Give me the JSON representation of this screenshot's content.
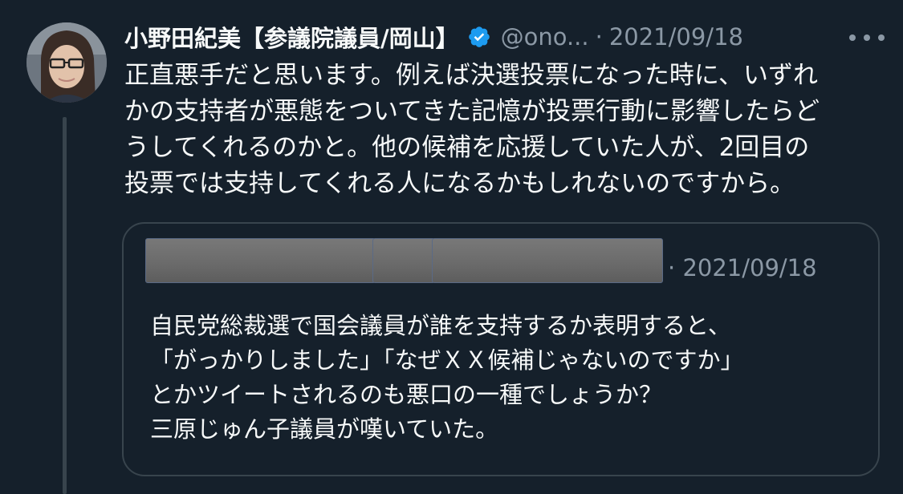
{
  "tweet": {
    "author_name": "小野田紀美【参議院議員/岡山】",
    "handle": "@ono...",
    "separator": "·",
    "date": "2021/09/18",
    "text_lines": [
      "正直悪手だと思います。例えば決選投票になった時に、いずれ",
      "かの支持者が悪態をついてきた記憶が投票行動に影響したらど",
      "うしてくれるのかと。他の候補を応援していた人が、2回目の",
      "投票では支持してくれる人になるかもしれないのですから。"
    ],
    "verified_icon": "verified-badge-icon",
    "more_icon": "more-options-icon"
  },
  "quoted_tweet": {
    "separator": "·",
    "date": "2021/09/18",
    "text_lines": [
      "自民党総裁選で国会議員が誰を支持するか表明すると、",
      "「がっかりしました」「なぜＸＸ候補じゃないのですか」",
      "とかツイートされるのも悪口の一種でしょうか？",
      "三原じゅん子議員が嘆いていた。"
    ]
  },
  "colors": {
    "background": "#15202b",
    "text_primary": "#f7f9f9",
    "text_secondary": "#8b98a5",
    "border": "#38444d",
    "verified": "#1d9bf0"
  }
}
